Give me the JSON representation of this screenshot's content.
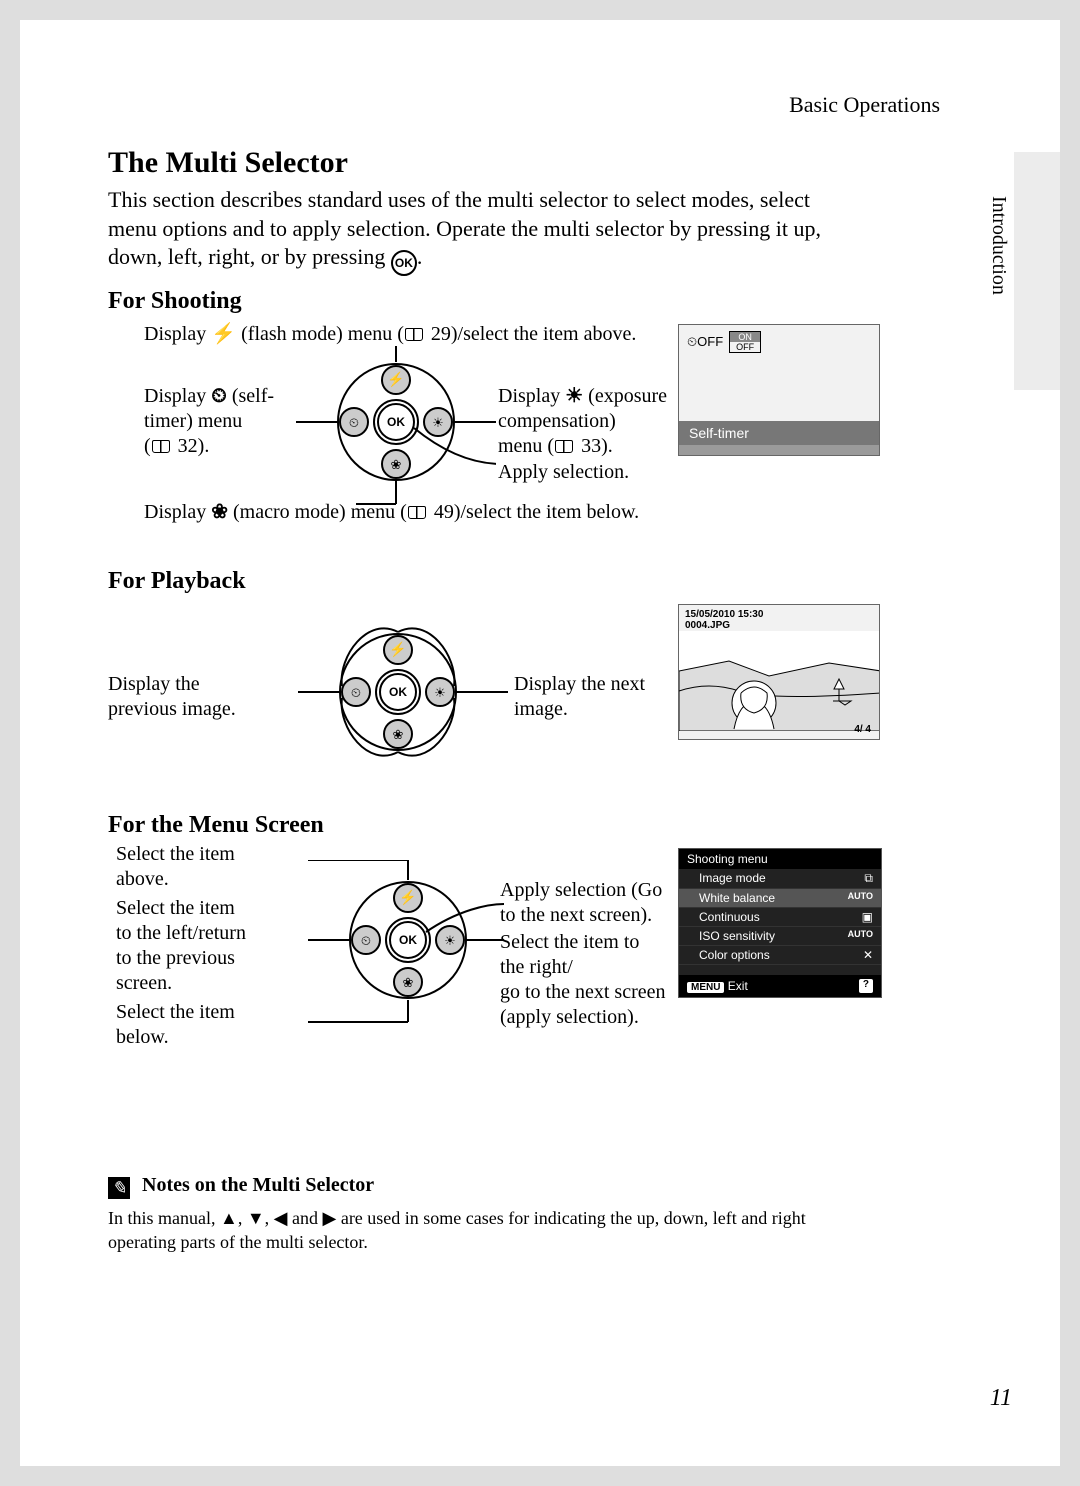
{
  "header": {
    "category": "Basic Operations"
  },
  "side_tab": "Introduction",
  "title": "The Multi Selector",
  "intro_line1": "This section describes standard uses of the multi selector to select modes, select",
  "intro_line2": "menu options and to apply selection. Operate the multi selector by pressing it up,",
  "intro_line3_prefix": "down, left, right, or by pressing ",
  "intro_line3_suffix": ".",
  "ok_label": "OK",
  "shooting": {
    "heading": "For Shooting",
    "top_prefix": "Display ",
    "top_mid": " (flash mode) menu (",
    "top_ref": " 29)/select the item above.",
    "left_l1": "Display ",
    "left_l1b": " (self-",
    "left_l2": "timer) menu",
    "left_l3_prefix": "(",
    "left_l3_ref": " 32).",
    "right_l1": "Display ",
    "right_l1b": " (exposure",
    "right_l2": "compensation)",
    "right_l3_prefix": "menu (",
    "right_l3_ref": " 33).",
    "apply": "Apply selection.",
    "bottom_prefix": "Display ",
    "bottom_mid": " (macro mode) menu (",
    "bottom_ref": " 49)/select the item below.",
    "lcd": {
      "on": "ON",
      "off": "OFF",
      "label": "Self-timer"
    }
  },
  "playback": {
    "heading": "For Playback",
    "left_l1": "Display the",
    "left_l2": "previous image.",
    "right_l1": "Display the next",
    "right_l2": "image.",
    "lcd": {
      "date": "15/05/2010  15:30",
      "file": "0004.JPG",
      "counter": "4/    4"
    }
  },
  "menu": {
    "heading": "For the Menu Screen",
    "up_l1": "Select the item",
    "up_l2": "above.",
    "left_l1": "Select the item",
    "left_l2": "to the left/return",
    "left_l3": "to the previous",
    "left_l4": "screen.",
    "down_l1": "Select the item",
    "down_l2": "below.",
    "ok_l1": "Apply selection (Go",
    "ok_l2": "to the next screen).",
    "right_l1": "Select the item to",
    "right_l2": "the right/",
    "right_l3": "go to the next screen",
    "right_l4": "(apply selection).",
    "screen": {
      "header": "Shooting menu",
      "rows": [
        {
          "label": "Image mode",
          "val": "⧉"
        },
        {
          "label": "White balance",
          "val": "AUTO"
        },
        {
          "label": "Continuous",
          "val": "▣"
        },
        {
          "label": "ISO sensitivity",
          "val": "AUTO"
        },
        {
          "label": "Color options",
          "val": "✕"
        }
      ],
      "exit_label": "Exit",
      "menu_badge": "MENU",
      "help": "?"
    }
  },
  "notes": {
    "heading": "Notes on the Multi Selector",
    "line1_a": "In this manual, ",
    "line1_b": ", ",
    "line1_c": ", ",
    "line1_d": " and ",
    "line1_e": " are used in some cases for indicating the up, down, left and right",
    "line2": "operating parts of the multi selector."
  },
  "page_number": "11"
}
